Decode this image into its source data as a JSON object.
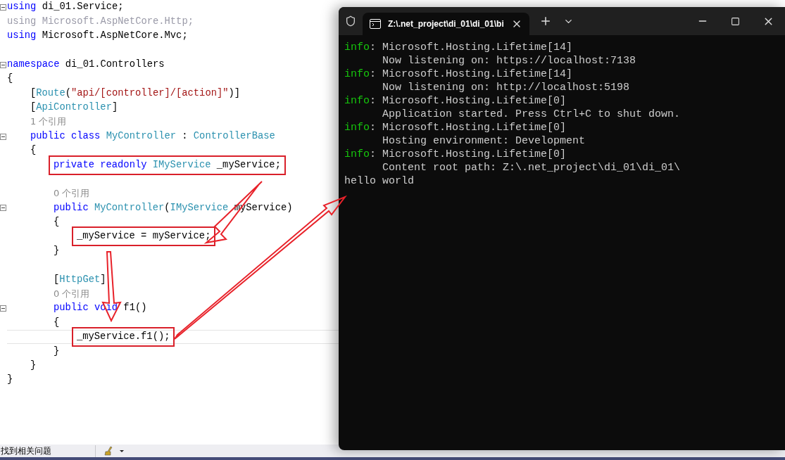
{
  "editor": {
    "lines": [
      {
        "kind": "code",
        "fold": true,
        "tokens": [
          {
            "kind": "kw",
            "text": "using"
          },
          {
            "kind": "plain",
            "text": " di_01.Service;"
          }
        ]
      },
      {
        "kind": "code",
        "tokens": [
          {
            "kind": "dim",
            "text": "using Microsoft.AspNetCore.Http;"
          }
        ]
      },
      {
        "kind": "code",
        "tokens": [
          {
            "kind": "kw",
            "text": "using"
          },
          {
            "kind": "plain",
            "text": " Microsoft.AspNetCore.Mvc;"
          }
        ]
      },
      {
        "kind": "blank"
      },
      {
        "kind": "code",
        "fold": true,
        "tokens": [
          {
            "kind": "kw",
            "text": "namespace"
          },
          {
            "kind": "plain",
            "text": " di_01.Controllers"
          }
        ]
      },
      {
        "kind": "code",
        "tokens": [
          {
            "kind": "plain",
            "text": "{"
          }
        ],
        "children": [
          {
            "kind": "code",
            "tokens": [
              {
                "kind": "plain",
                "text": "["
              },
              {
                "kind": "type",
                "text": "Route"
              },
              {
                "kind": "plain",
                "text": "("
              },
              {
                "kind": "string",
                "text": "\"api/[controller]/[action]\""
              },
              {
                "kind": "plain",
                "text": ")]"
              }
            ]
          },
          {
            "kind": "code",
            "tokens": [
              {
                "kind": "plain",
                "text": "["
              },
              {
                "kind": "type",
                "text": "ApiController"
              },
              {
                "kind": "plain",
                "text": "]"
              }
            ]
          },
          {
            "kind": "code",
            "tokens": [
              {
                "kind": "ref",
                "text": "1 个引用"
              }
            ]
          },
          {
            "kind": "code",
            "fold": true,
            "tokens": [
              {
                "kind": "kw",
                "text": "public class "
              },
              {
                "kind": "type",
                "text": "MyController"
              },
              {
                "kind": "plain",
                "text": " : "
              },
              {
                "kind": "type",
                "text": "ControllerBase"
              }
            ]
          },
          {
            "kind": "code",
            "tokens": [
              {
                "kind": "plain",
                "text": "{"
              }
            ],
            "children": [
              {
                "kind": "code",
                "boxed": true,
                "tokens": [
                  {
                    "kind": "kw",
                    "text": "private readonly "
                  },
                  {
                    "kind": "type",
                    "text": "IMyService"
                  },
                  {
                    "kind": "plain",
                    "text": " _myService;"
                  }
                ]
              },
              {
                "kind": "blank"
              },
              {
                "kind": "code",
                "tokens": [
                  {
                    "kind": "ref",
                    "text": "0 个引用"
                  }
                ]
              },
              {
                "kind": "code",
                "fold": true,
                "tokens": [
                  {
                    "kind": "kw",
                    "text": "public "
                  },
                  {
                    "kind": "type",
                    "text": "MyController"
                  },
                  {
                    "kind": "plain",
                    "text": "("
                  },
                  {
                    "kind": "type",
                    "text": "IMyService"
                  },
                  {
                    "kind": "plain",
                    "text": " myService)"
                  }
                ]
              },
              {
                "kind": "code",
                "tokens": [
                  {
                    "kind": "plain",
                    "text": "{"
                  }
                ],
                "children": [
                  {
                    "kind": "code",
                    "boxed": true,
                    "tokens": [
                      {
                        "kind": "plain",
                        "text": "_myService = myService;"
                      }
                    ]
                  }
                ]
              },
              {
                "kind": "code",
                "tokens": [
                  {
                    "kind": "plain",
                    "text": "}"
                  }
                ]
              },
              {
                "kind": "blank"
              },
              {
                "kind": "code",
                "tokens": [
                  {
                    "kind": "plain",
                    "text": "["
                  },
                  {
                    "kind": "type",
                    "text": "HttpGet"
                  },
                  {
                    "kind": "plain",
                    "text": "]"
                  }
                ]
              },
              {
                "kind": "code",
                "tokens": [
                  {
                    "kind": "ref",
                    "text": "0 个引用"
                  }
                ]
              },
              {
                "kind": "code",
                "fold": true,
                "tokens": [
                  {
                    "kind": "kw",
                    "text": "public void "
                  },
                  {
                    "kind": "plain",
                    "text": "f1()"
                  }
                ]
              },
              {
                "kind": "code",
                "tokens": [
                  {
                    "kind": "plain",
                    "text": "{"
                  }
                ],
                "children": [
                  {
                    "kind": "code",
                    "boxed": true,
                    "current": true,
                    "tokens": [
                      {
                        "kind": "plain",
                        "text": "_myService.f1();"
                      }
                    ]
                  }
                ]
              },
              {
                "kind": "code",
                "tokens": [
                  {
                    "kind": "plain",
                    "text": "}"
                  }
                ]
              }
            ]
          },
          {
            "kind": "code",
            "tokens": [
              {
                "kind": "plain",
                "text": "}"
              }
            ]
          }
        ]
      },
      {
        "kind": "code",
        "tokens": [
          {
            "kind": "plain",
            "text": "}"
          }
        ]
      }
    ]
  },
  "status_bar": {
    "message": "找到相关问题"
  },
  "terminal": {
    "tab_title": "Z:\\.net_project\\di_01\\di_01\\bi",
    "lines": [
      {
        "level": "info",
        "text": ": Microsoft.Hosting.Lifetime[14]"
      },
      {
        "indent": true,
        "text": "Now listening on: https://localhost:7138"
      },
      {
        "level": "info",
        "text": ": Microsoft.Hosting.Lifetime[14]"
      },
      {
        "indent": true,
        "text": "Now listening on: http://localhost:5198"
      },
      {
        "level": "info",
        "text": ": Microsoft.Hosting.Lifetime[0]"
      },
      {
        "indent": true,
        "text": "Application started. Press Ctrl+C to shut down."
      },
      {
        "level": "info",
        "text": ": Microsoft.Hosting.Lifetime[0]"
      },
      {
        "indent": true,
        "text": "Hosting environment: Development"
      },
      {
        "level": "info",
        "text": ": Microsoft.Hosting.Lifetime[0]"
      },
      {
        "indent": true,
        "text": "Content root path: Z:\\.net_project\\di_01\\di_01\\"
      },
      {
        "text": "hello world"
      }
    ]
  }
}
